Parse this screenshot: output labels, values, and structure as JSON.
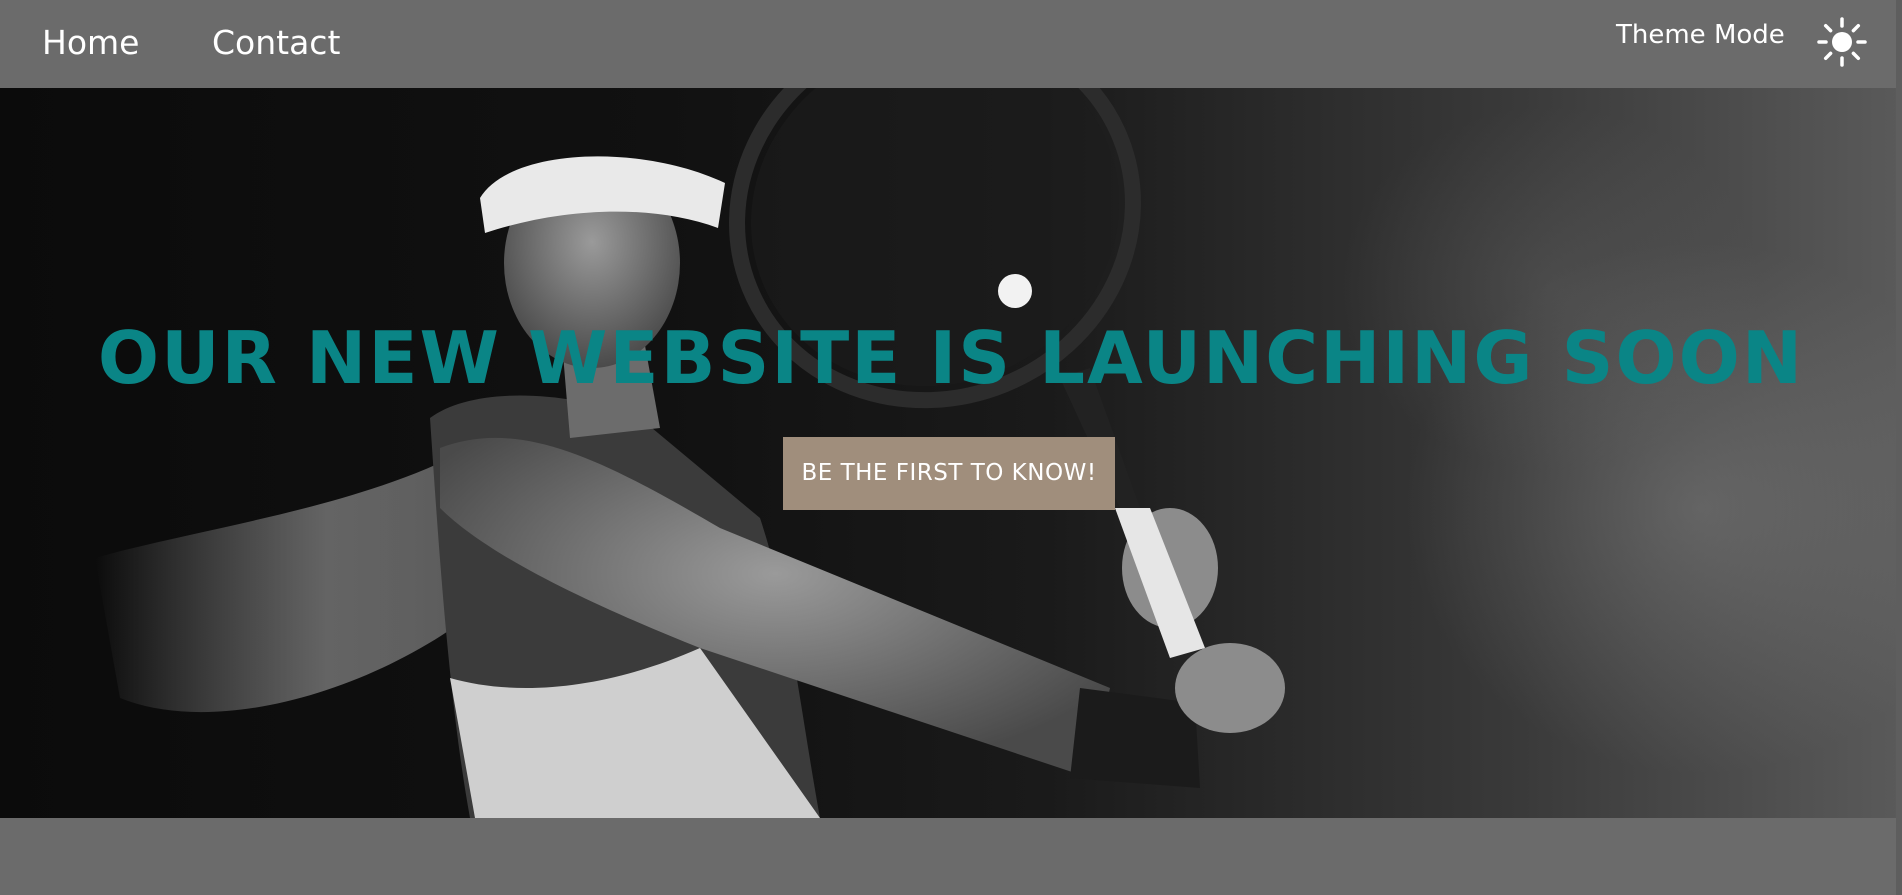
{
  "nav": {
    "home_label": "Home",
    "contact_label": "Contact",
    "theme_label": "Theme Mode",
    "theme_icon": "sun-icon"
  },
  "hero": {
    "headline": "OUR NEW WEBSITE IS LAUNCHING SOON",
    "cta_label": "BE THE FIRST TO KNOW!",
    "image": "tennis-player-photo"
  },
  "colors": {
    "page_background": "#6b6b6b",
    "headline": "#0a8586",
    "cta_background": "#a08e7c",
    "text": "#ffffff"
  }
}
